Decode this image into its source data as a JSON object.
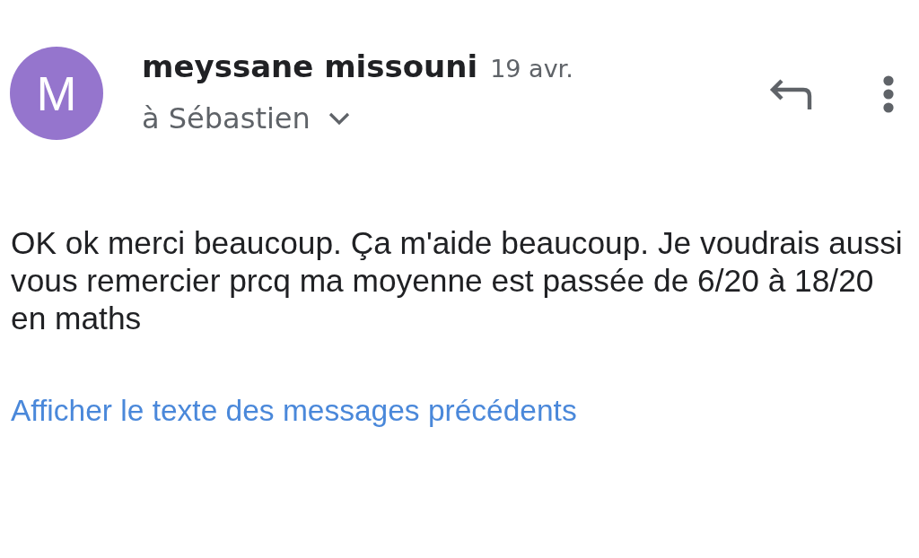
{
  "sender": {
    "initial": "M",
    "name": "meyssane missouni",
    "date": "19 avr.",
    "recipient": "à Sébastien"
  },
  "message": {
    "body": "OK ok merci beaucoup. Ça m'aide beaucoup. Je voudrais aussi vous remercier prcq ma moyenne est passée de 6/20 à 18/20 en maths",
    "show_quoted_link": "Afficher le texte des messages précédents"
  }
}
